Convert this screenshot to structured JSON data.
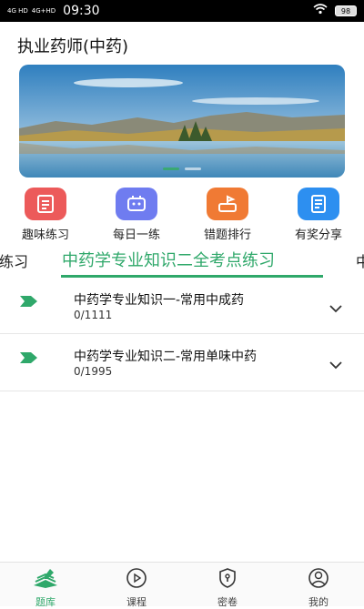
{
  "status": {
    "net1": "4G HD",
    "net2": "4G+HD",
    "time": "09:30",
    "battery": "98"
  },
  "header": {
    "title": "执业药师(中药)"
  },
  "quick": [
    {
      "label": "趣味练习",
      "icon": "quiz-icon",
      "color": "#ec5a5a"
    },
    {
      "label": "每日一练",
      "icon": "daily-practice-icon",
      "color": "#6f7cf0"
    },
    {
      "label": "错题排行",
      "icon": "wrong-rank-icon",
      "color": "#f07a34"
    },
    {
      "label": "有奖分享",
      "icon": "share-icon",
      "color": "#2d8ff0"
    }
  ],
  "tabs": {
    "prev": "练习",
    "active": "中药学专业知识二全考点练习",
    "next": "中"
  },
  "list": [
    {
      "title": "中药学专业知识一-常用中成药",
      "count": "0/1111"
    },
    {
      "title": "中药学专业知识二-常用单味中药",
      "count": "0/1995"
    }
  ],
  "nav": [
    {
      "label": "题库",
      "icon": "question-bank-icon"
    },
    {
      "label": "课程",
      "icon": "course-play-icon"
    },
    {
      "label": "密卷",
      "icon": "secret-paper-icon"
    },
    {
      "label": "我的",
      "icon": "profile-icon"
    }
  ]
}
